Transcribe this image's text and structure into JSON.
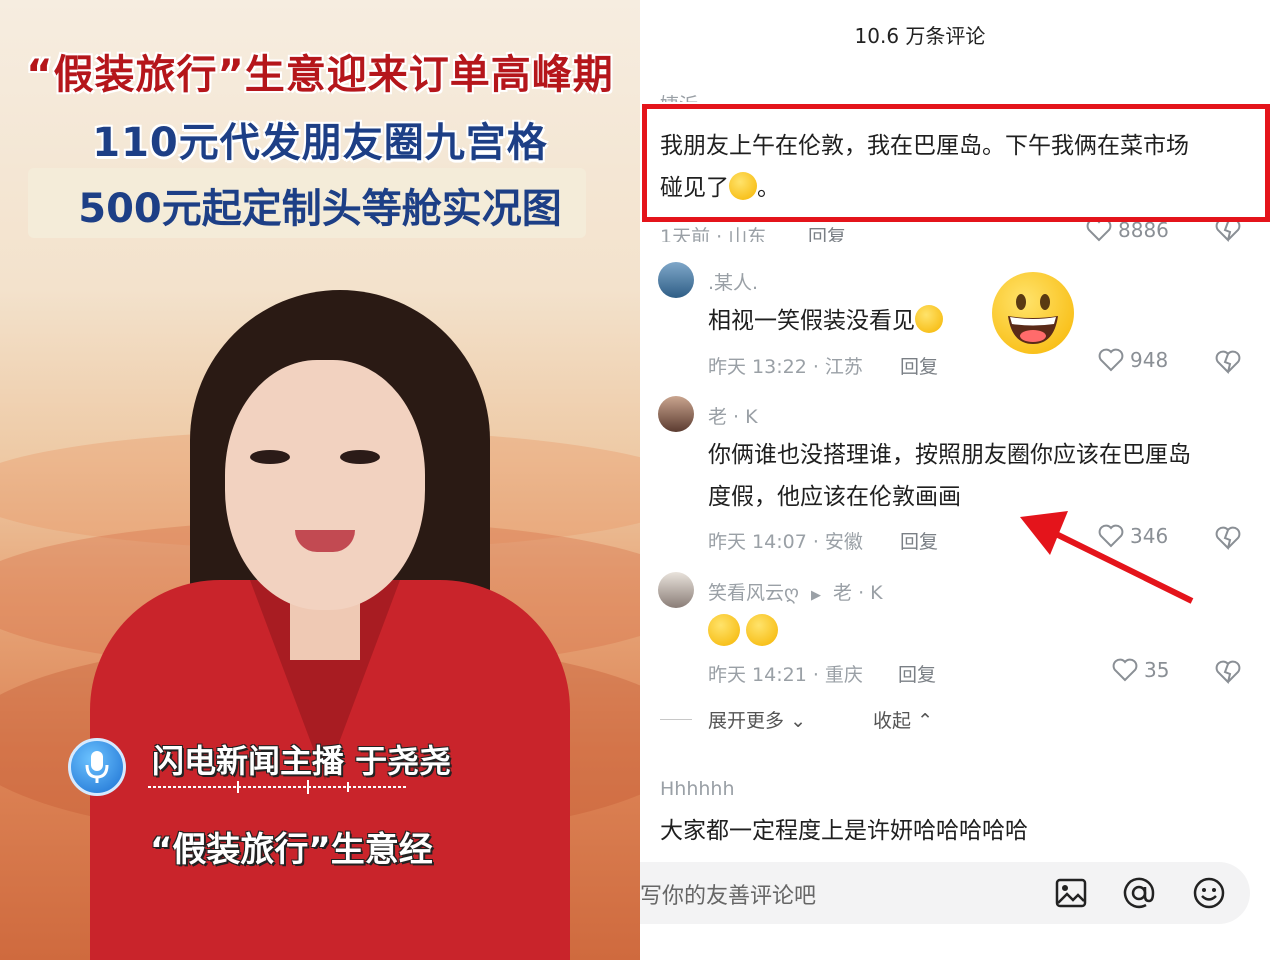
{
  "news_frame": {
    "headline_line1": "“假装旅行”生意迎来订单高峰期",
    "headline_line2": "110元代发朋友圈九宫格",
    "headline_line3": "500元起定制头等舱实况图",
    "anchor_caption": "闪电新闻主播 于尧尧",
    "subtitle": "“假装旅行”生意经",
    "icon": "microphone-icon"
  },
  "comments_panel": {
    "title": "10.6 万条评论",
    "comments": [
      {
        "user": "婕沂",
        "text_line1": "我朋友上午在伦敦，我在巴厘岛。下午我俩在菜市场",
        "text_line2": "碰见了",
        "text_tail": "。",
        "meta": "1天前 · 山东",
        "reply": "回复",
        "likes": "8886"
      },
      {
        "user": ".某人.",
        "text": "相视一笑假装没看见",
        "meta": "昨天 13:22 · 江苏",
        "reply": "回复",
        "likes": "948"
      },
      {
        "user": "老 · K",
        "text_line1": "你俩谁也没搭理谁，按照朋友圈你应该在巴厘岛",
        "text_line2": "度假，他应该在伦敦画画",
        "meta": "昨天 14:07 · 安徽",
        "reply": "回复",
        "likes": "346"
      },
      {
        "user": "笑看风云ღ",
        "reply_to": "老 · K",
        "meta": "昨天 14:21 · 重庆",
        "reply": "回复",
        "likes": "35"
      },
      {
        "user": "Hhhhhh",
        "text": "大家都一定程度上是许妍哈哈哈哈哈"
      }
    ],
    "expand_more": "展开更多",
    "collapse": "收起",
    "input_placeholder": "写你的友善评论吧",
    "highlight_color": "#e4141b"
  }
}
